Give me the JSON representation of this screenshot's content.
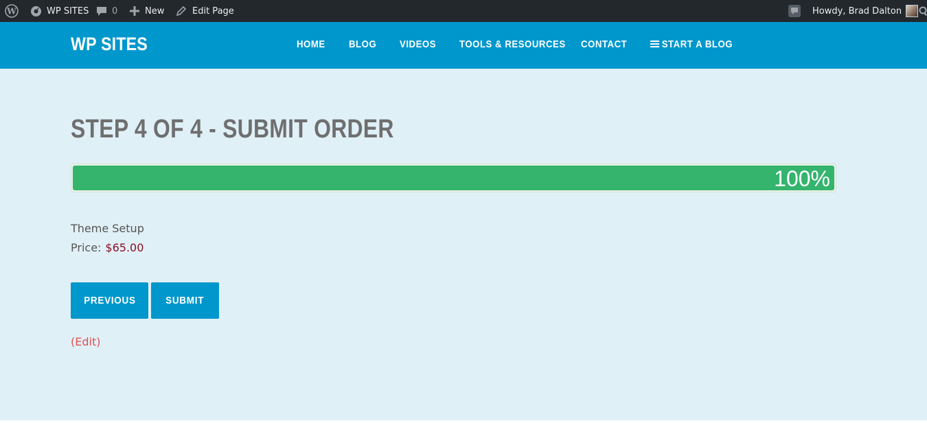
{
  "admin_bar": {
    "site_name": "WP SITES",
    "comments_count": "0",
    "new_label": "New",
    "edit_page_label": "Edit Page",
    "howdy_text": "Howdy, Brad Dalton"
  },
  "header": {
    "site_title": "WP SITES",
    "nav": [
      "HOME",
      "BLOG",
      "VIDEOS",
      "TOOLS & RESOURCES",
      "CONTACT",
      "START A BLOG"
    ]
  },
  "main": {
    "page_title": "STEP 4 OF 4 - SUBMIT ORDER",
    "progress": {
      "value_percent": 100,
      "label": "100%"
    },
    "product_name": "Theme Setup",
    "price_label": "Price:",
    "price_value": "$65.00",
    "previous_button": "PREVIOUS",
    "submit_button": "SUBMIT",
    "edit_link": "(Edit)"
  },
  "colors": {
    "admin_bar": "#23282d",
    "header": "#0097cc",
    "content_bg": "#e0f0f7",
    "progress": "#34b46d",
    "price": "#8a1020",
    "edit_link": "#e05050"
  },
  "icons": [
    "wordpress-icon",
    "dashboard-icon",
    "comment-icon",
    "plus-icon",
    "pencil-icon",
    "notification-icon",
    "avatar",
    "search-icon",
    "menu-icon"
  ]
}
